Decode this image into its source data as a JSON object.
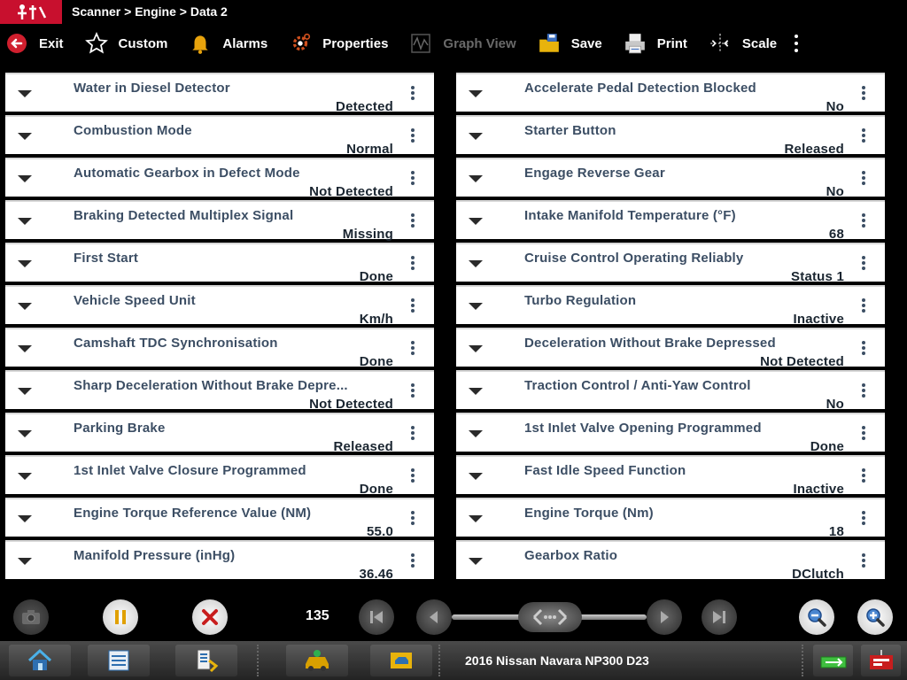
{
  "app": {
    "breadcrumb": "Scanner > Engine > Data 2"
  },
  "toolbar": {
    "exit": "Exit",
    "custom": "Custom",
    "alarms": "Alarms",
    "properties": "Properties",
    "graph_view": "Graph View",
    "save": "Save",
    "print": "Print",
    "scale": "Scale"
  },
  "left_params": [
    {
      "name": "Water in Diesel Detector",
      "value": "Detected"
    },
    {
      "name": "Combustion Mode",
      "value": "Normal"
    },
    {
      "name": "Automatic Gearbox in Defect Mode",
      "value": "Not Detected"
    },
    {
      "name": "Braking Detected Multiplex Signal",
      "value": "Missing"
    },
    {
      "name": "First Start",
      "value": "Done"
    },
    {
      "name": "Vehicle Speed Unit",
      "value": "Km/h"
    },
    {
      "name": "Camshaft TDC Synchronisation",
      "value": "Done"
    },
    {
      "name": "Sharp Deceleration Without Brake Depre...",
      "value": "Not Detected"
    },
    {
      "name": "Parking Brake",
      "value": "Released"
    },
    {
      "name": "1st Inlet Valve Closure Programmed",
      "value": "Done"
    },
    {
      "name": "Engine Torque Reference Value (NM)",
      "value": "55.0"
    },
    {
      "name": "Manifold Pressure (inHg)",
      "value": "36.46"
    }
  ],
  "right_params": [
    {
      "name": "Accelerate Pedal Detection Blocked",
      "value": "No"
    },
    {
      "name": "Starter Button",
      "value": "Released"
    },
    {
      "name": "Engage Reverse Gear",
      "value": "No"
    },
    {
      "name": "Intake Manifold Temperature (°F)",
      "value": "68"
    },
    {
      "name": "Cruise Control Operating Reliably",
      "value": "Status 1"
    },
    {
      "name": "Turbo Regulation",
      "value": "Inactive"
    },
    {
      "name": "Deceleration Without Brake Depressed",
      "value": "Not Detected"
    },
    {
      "name": "Traction Control / Anti-Yaw Control",
      "value": "No"
    },
    {
      "name": "1st Inlet Valve Opening Programmed",
      "value": "Done"
    },
    {
      "name": "Fast Idle Speed Function",
      "value": "Inactive"
    },
    {
      "name": "Engine Torque (Nm)",
      "value": "18"
    },
    {
      "name": "Gearbox Ratio",
      "value": "DClutch"
    }
  ],
  "playback": {
    "frame": "135"
  },
  "status": {
    "vehicle": "2016 Nissan Navara NP300 D23"
  },
  "colors": {
    "brand_red": "#c8102e",
    "param_name": "#3c4e64",
    "value_text": "#1a2530"
  }
}
